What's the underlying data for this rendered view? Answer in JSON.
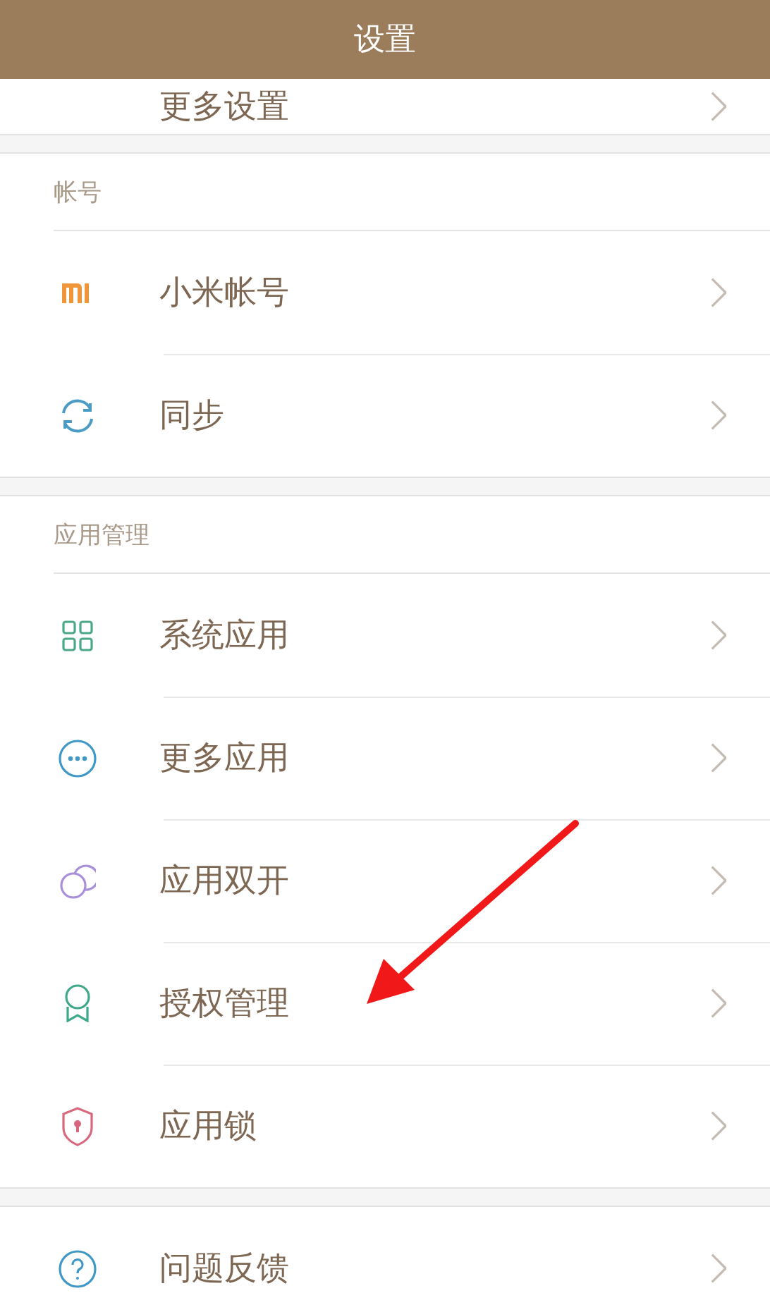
{
  "header": {
    "title": "设置"
  },
  "sections": [
    {
      "items": [
        {
          "kind": "none",
          "label": "更多设置"
        }
      ]
    },
    {
      "title": "帐号",
      "items": [
        {
          "kind": "mi",
          "label": "小米帐号"
        },
        {
          "kind": "sync",
          "label": "同步"
        }
      ]
    },
    {
      "title": "应用管理",
      "items": [
        {
          "kind": "grid",
          "label": "系统应用"
        },
        {
          "kind": "more",
          "label": "更多应用"
        },
        {
          "kind": "dual",
          "label": "应用双开"
        },
        {
          "kind": "badge",
          "label": "授权管理"
        },
        {
          "kind": "shield",
          "label": "应用锁"
        }
      ]
    },
    {
      "items": [
        {
          "kind": "help",
          "label": "问题反馈"
        }
      ]
    }
  ]
}
